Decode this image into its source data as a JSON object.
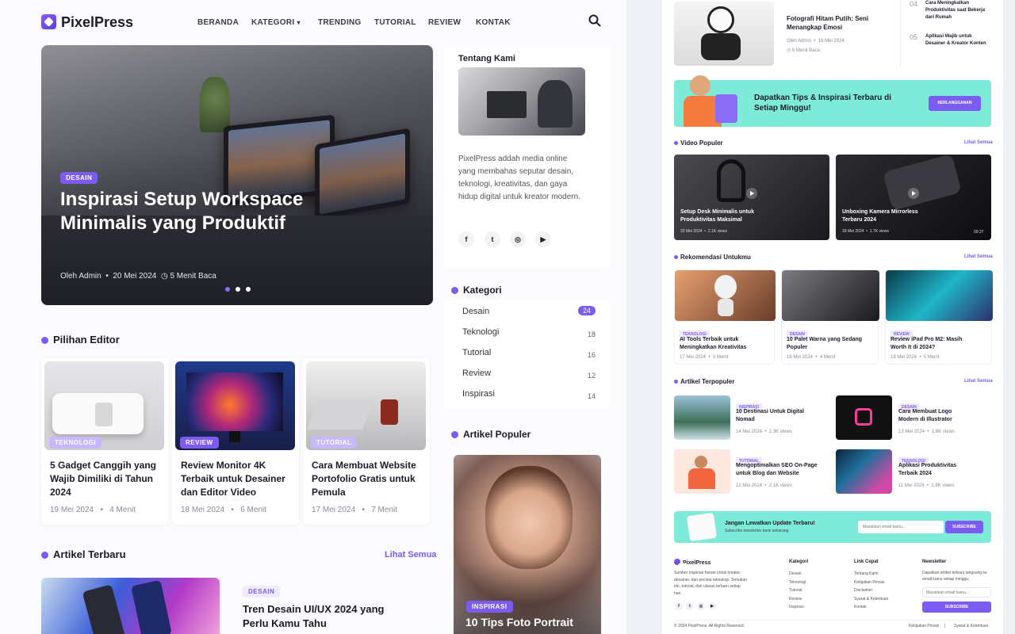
{
  "header": {
    "logo": "PixelPress",
    "nav": [
      "BERANDA",
      "KATEGORI",
      "TRENDING",
      "TUTORIAL",
      "REVIEW",
      "KONTAK"
    ]
  },
  "hero": {
    "tag": "DESAIN",
    "title": "Inspirasi Setup Workspace Minimalis yang Produktif",
    "author": "Oleh Admin",
    "date": "20 Mei 2024",
    "read": "5 Menit Baca"
  },
  "editor": {
    "title": "Pilihan Editor",
    "cards": [
      {
        "tag": "TEKNOLOGI",
        "title": "5 Gadget Canggih yang Wajib Dimiliki di Tahun 2024",
        "date": "19 Mei 2024",
        "read": "4 Menit"
      },
      {
        "tag": "REVIEW",
        "title": "Review Monitor 4K Terbaik untuk Desainer dan Editor Video",
        "date": "18 Mei 2024",
        "read": "6 Menit"
      },
      {
        "tag": "TUTORIAL",
        "title": "Cara Membuat Website Portofolio Gratis untuk Pemula",
        "date": "17 Mei 2024",
        "read": "7 Menit"
      }
    ]
  },
  "latest": {
    "title": "Artikel Terbaru",
    "see_all": "Lihat Semua",
    "item": {
      "tag": "DESAIN",
      "title": "Tren Desain UI/UX 2024 yang Perlu Kamu Tahu"
    }
  },
  "about": {
    "title": "Tentang Kami",
    "text": "PixelPress addah media online yang membahas seputar desain, teknologi, kreativitas, dan gaya hidup digital untuk kreator modern."
  },
  "categories": {
    "title": "Kategori",
    "items": [
      {
        "name": "Desain",
        "count": "24"
      },
      {
        "name": "Teknologi",
        "count": "18"
      },
      {
        "name": "Tutorial",
        "count": "16"
      },
      {
        "name": "Review",
        "count": "12"
      },
      {
        "name": "Inspirasi",
        "count": "14"
      }
    ]
  },
  "popular": {
    "title": "Artikel Populer",
    "feature": {
      "tag": "INSPIRASI",
      "title": "10 Tips Foto Portrait"
    }
  },
  "right": {
    "top_article": {
      "title": "Fotografi Hitam Putih: Seni Menangkap Emosi",
      "author": "Oleh Admin",
      "date": "16 Mei 2024",
      "read": "6 Menit Baca"
    },
    "ranked": [
      {
        "num": "04",
        "title": "Cara Meningkatkan Produktivitas saat Bekerja dari Rumah"
      },
      {
        "num": "05",
        "title": "Aplikasi Wajib untuk Desainer & Kreator Konten"
      }
    ],
    "promo": {
      "title": "Dapatkan Tips & Inspirasi Terbaru di Setiap Minggu!",
      "button": "BERLANGGANAN"
    },
    "videos": {
      "title": "Video Populer",
      "see_all": "Lihat Semua",
      "items": [
        {
          "title": "Setup Desk Minimalis untuk Produktivitas Maksimal",
          "date": "20 Mei 2024",
          "views": "2.1K views",
          "duration": ""
        },
        {
          "title": "Unboxing Kamera Mirrorless Terbaru 2024",
          "date": "18 Mei 2024",
          "views": "1.7K views",
          "duration": "09:37"
        }
      ]
    },
    "recommend": {
      "title": "Rekomendasi Untukmu",
      "see_all": "Lihat Semua",
      "items": [
        {
          "tag": "TEKNOLOGI",
          "title": "AI Tools Terbaik untuk Meningkatkan Kreativitas",
          "date": "17 Mei 2024",
          "read": "3 Menit"
        },
        {
          "tag": "DESAIN",
          "title": "10 Palet Warna yang Sedang Populer",
          "date": "16 Mei 2024",
          "read": "4 Menit"
        },
        {
          "tag": "REVIEW",
          "title": "Review iPad Pro M2: Masih Worth It di 2024?",
          "date": "18 Mei 2024",
          "read": "5 Menit"
        }
      ]
    },
    "most_read": {
      "title": "Artikel Terpopuler",
      "see_all": "Lihat Semua",
      "items": [
        {
          "tag": "INSPIRASI",
          "title": "10 Destinasi Untuk Digital Nomad",
          "date": "14 Mei 2024",
          "views": "2.3K views"
        },
        {
          "tag": "DESAIN",
          "title": "Cara Membuat Logo Modern di Illustrator",
          "date": "13 Mei 2024",
          "views": "1.9K views"
        },
        {
          "tag": "TUTORIAL",
          "title": "Mengoptimalkan SEO On-Page untuk Blog dan Website",
          "date": "12 Mei 2024",
          "views": "2.1K views"
        },
        {
          "tag": "TEKNOLOGI",
          "title": "Aplikasi Produktivitas Terbaik 2024",
          "date": "11 Mei 2024",
          "views": "1.8K views"
        }
      ]
    },
    "newsletter_bar": {
      "title": "Jangan Lewatkan Update Terbaru!",
      "sub": "Subscribe newsletter kami sekarang.",
      "placeholder": "Masukkan email kamu...",
      "button": "SUBSCRIBE"
    },
    "footer": {
      "logo": "PixelPress",
      "about": "Sumber inspirasi harian untuk kreator, desainer, dan pecinta teknologi. Temukan ide, tutorial, dan ulasan terbaru setiap hari.",
      "cat_title": "Kategori",
      "cats": [
        "Desain",
        "Teknologi",
        "Tutorial",
        "Review",
        "Inspirasi"
      ],
      "links_title": "Link Cepat",
      "links": [
        "Tentang Kami",
        "Kebijakan Privasi",
        "Disclaimer",
        "Syarat & Ketentuan",
        "Kontak"
      ],
      "news_title": "Newsletter",
      "news_text": "Dapatkan artikel terbaru langsung ke email kamu setiap minggu.",
      "news_placeholder": "Masukkan email kamu...",
      "news_button": "SUBSCRIBE",
      "copyright": "© 2024 PixelPress. All Rights Reserved.",
      "privacy": "Kebijakan Privasi",
      "terms": "Syarat & Ketentuan"
    }
  },
  "colors": {
    "accent": "#7c5cf0",
    "mint": "#6ee7d2",
    "bg": "#eef1f6"
  }
}
